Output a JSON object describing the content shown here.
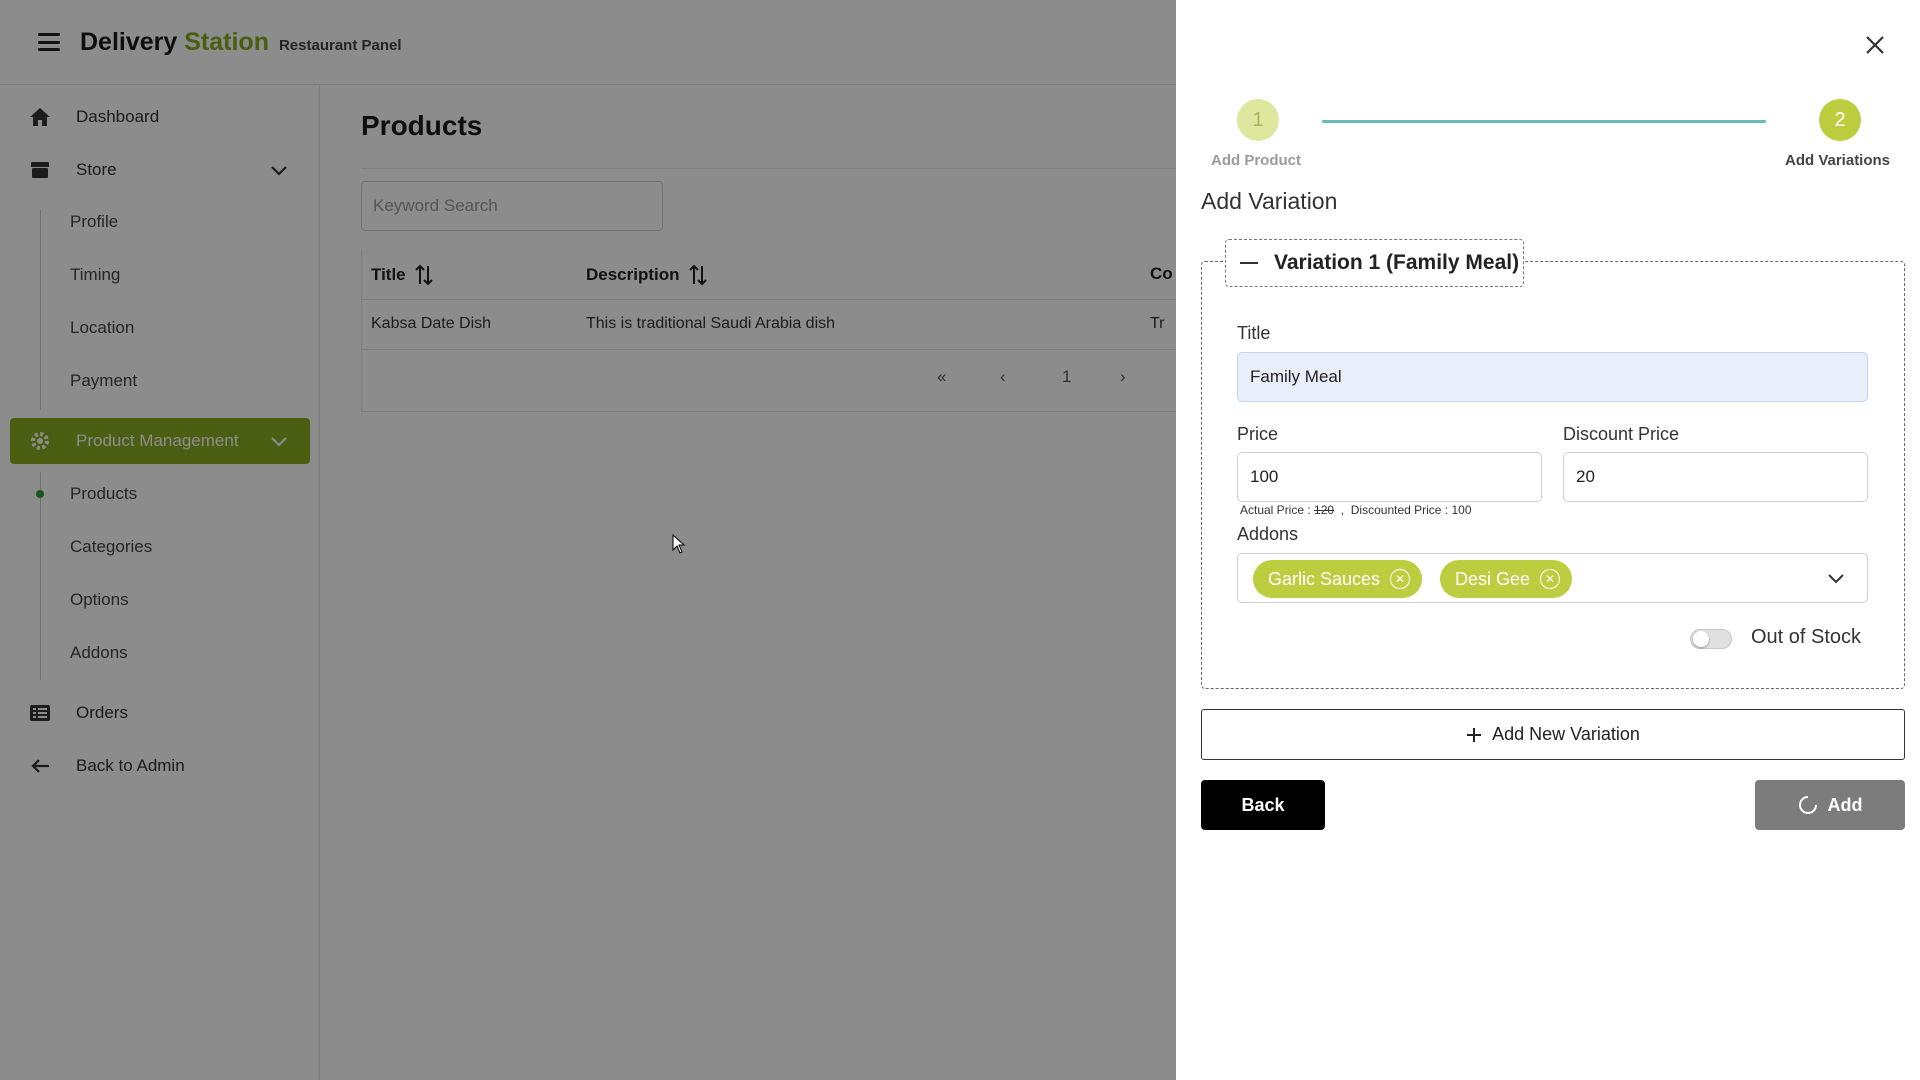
{
  "header": {
    "brand_main": "Delivery",
    "brand_accent": "Station",
    "brand_sub": "Restaurant Panel"
  },
  "sidebar": {
    "dashboard": "Dashboard",
    "store": "Store",
    "store_items": [
      "Profile",
      "Timing",
      "Location",
      "Payment"
    ],
    "product_management": "Product Management",
    "product_items": [
      "Products",
      "Categories",
      "Options",
      "Addons"
    ],
    "orders": "Orders",
    "back_to_admin": "Back to Admin"
  },
  "main": {
    "title": "Products",
    "search_placeholder": "Keyword Search",
    "columns": [
      "Title",
      "Description",
      "Co"
    ],
    "rows": [
      {
        "title": "Kabsa Date Dish",
        "description": "This is traditional Saudi Arabia dish",
        "c": "Tr"
      }
    ],
    "pagination": {
      "first": "«",
      "prev": "‹",
      "page": "1",
      "next": "›"
    }
  },
  "drawer": {
    "steps": [
      {
        "number": "1",
        "label": "Add Product"
      },
      {
        "number": "2",
        "label": "Add Variations"
      }
    ],
    "title": "Add Variation",
    "variation": {
      "header": "Variation 1 (Family Meal)",
      "title_label": "Title",
      "title_value": "Family Meal",
      "price_label": "Price",
      "price_value": "100",
      "discount_label": "Discount Price",
      "discount_value": "20",
      "hint_actual_label": "Actual Price :",
      "hint_actual_value": "120",
      "hint_sep": ",",
      "hint_discounted_label": "Discounted Price :",
      "hint_discounted_value": "100",
      "addons_label": "Addons",
      "addons": [
        "Garlic Sauces",
        "Desi Gee"
      ],
      "out_of_stock_label": "Out of Stock",
      "out_of_stock": false
    },
    "add_new_variation": "Add New Variation",
    "back": "Back",
    "add": "Add"
  },
  "colors": {
    "accent": "#8bab1f",
    "chip": "#bccd3f",
    "step_line": "#6ab7c0"
  }
}
